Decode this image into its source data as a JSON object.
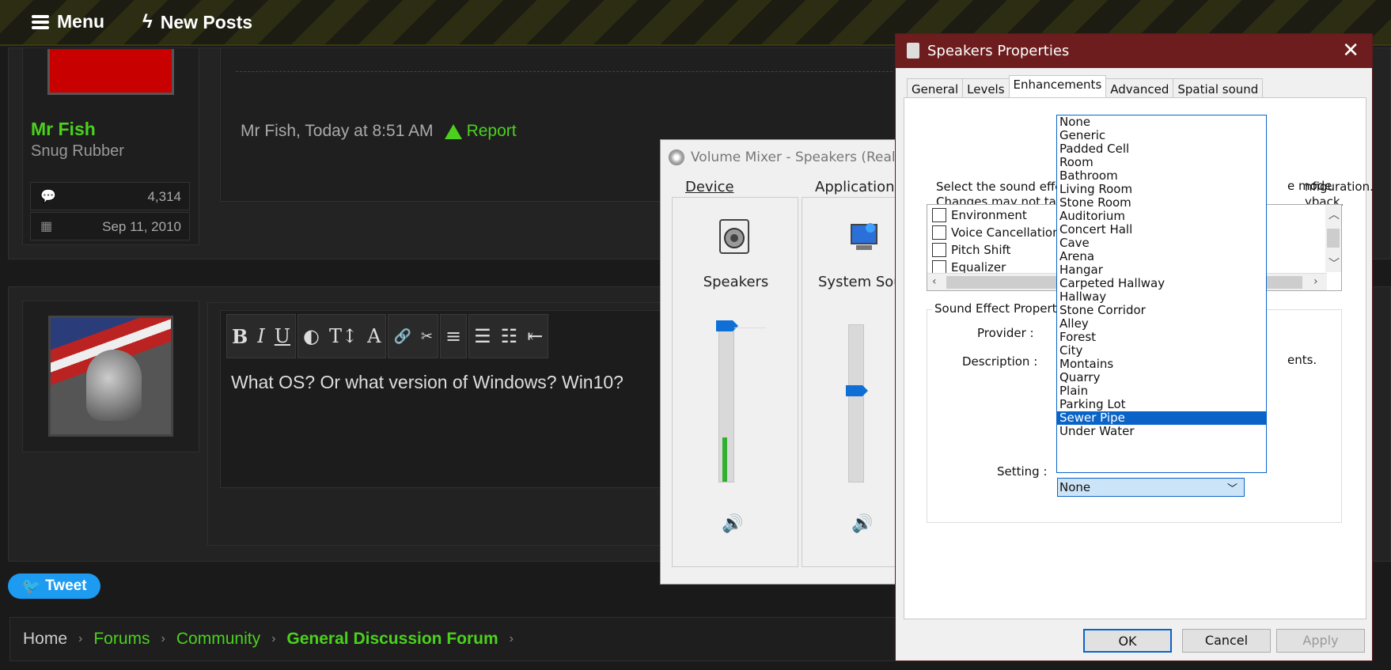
{
  "forum": {
    "menu_label": "Menu",
    "new_posts_label": "New Posts",
    "user": {
      "name": "Mr Fish",
      "title": "Snug Rubber",
      "messages": "4,314",
      "joined": "Sep 11, 2010"
    },
    "post_meta": "Mr Fish, Today at 8:51 AM",
    "report_label": "Report",
    "editor_text": "What OS? Or what version of Windows? Win10?",
    "toolbar": [
      "B",
      "I",
      "U",
      "◐",
      "T↕",
      "A",
      "🔗",
      "✂",
      "≡",
      "☰",
      "☷",
      "⇤"
    ],
    "tweet_label": "Tweet",
    "breadcrumbs": [
      "Home",
      "Forums",
      "Community",
      "General Discussion Forum"
    ]
  },
  "mixer": {
    "title": "Volume Mixer - Speakers (Realtek",
    "device_header": "Device",
    "apps_header": "Applications",
    "device_name": "Speakers",
    "app_name": "System Sounds"
  },
  "dialog": {
    "title": "Speakers Properties",
    "tabs": [
      "General",
      "Levels",
      "Enhancements",
      "Advanced",
      "Spatial sound"
    ],
    "selected_tab": "Enhancements",
    "desc_line1": "Select the sound effects",
    "desc_line2": "Changes may not take",
    "desc_tail1": "nfiguration.",
    "desc_tail2": "yback.",
    "exclusive_tail": "e mode",
    "effects": [
      "Environment",
      "Voice Cancellation",
      "Pitch Shift",
      "Equalizer"
    ],
    "group_label": "Sound Effect Properties",
    "provider_label": "Provider :",
    "description_label": "Description :",
    "description_tail": "ents.",
    "setting_label": "Setting :",
    "setting_value": "None",
    "options": [
      "None",
      "Generic",
      "Padded Cell",
      "Room",
      "Bathroom",
      "Living Room",
      "Stone Room",
      "Auditorium",
      "Concert Hall",
      "Cave",
      "Arena",
      "Hangar",
      "Carpeted Hallway",
      "Hallway",
      "Stone Corridor",
      "Alley",
      "Forest",
      "City",
      "Montains",
      "Quarry",
      "Plain",
      "Parking Lot",
      "Sewer Pipe",
      "Under Water"
    ],
    "highlighted_option": "Sewer Pipe",
    "ok_label": "OK",
    "cancel_label": "Cancel",
    "apply_label": "Apply"
  }
}
